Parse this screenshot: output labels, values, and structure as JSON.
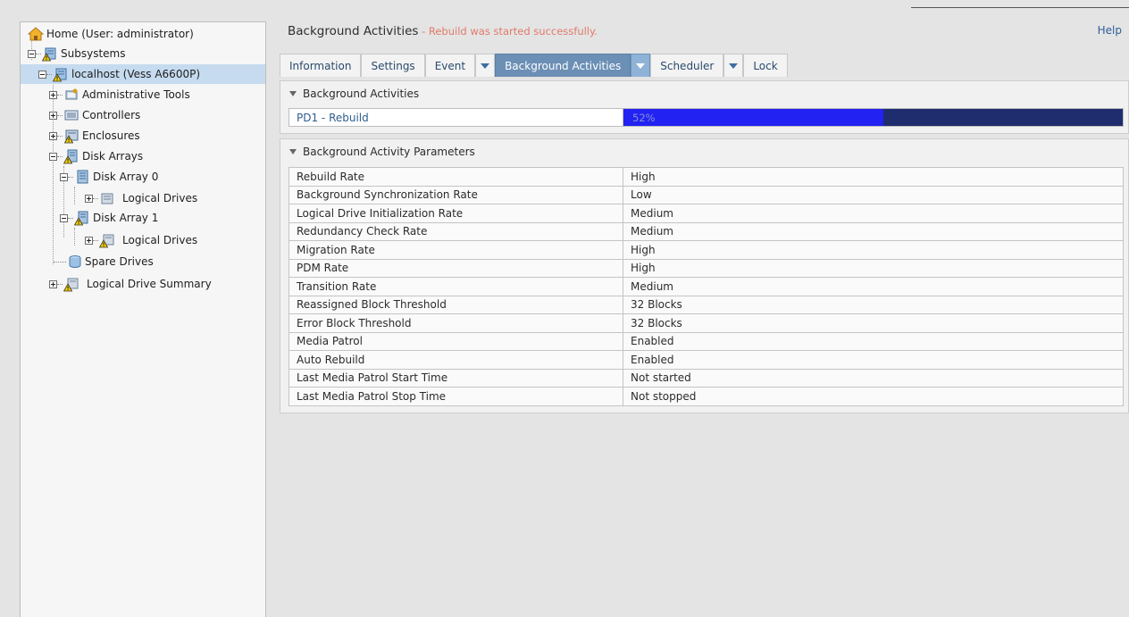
{
  "tree": {
    "nodes": [
      {
        "label": "Home (User: administrator)"
      },
      {
        "label": "Subsystems"
      },
      {
        "label": "localhost (Vess A6600P)"
      },
      {
        "label": "Administrative Tools"
      },
      {
        "label": "Controllers"
      },
      {
        "label": "Enclosures"
      },
      {
        "label": "Disk Arrays"
      },
      {
        "label": "Disk Array 0"
      },
      {
        "label": "Logical Drives"
      },
      {
        "label": "Disk Array 1"
      },
      {
        "label": "Logical Drives"
      },
      {
        "label": "Spare Drives"
      },
      {
        "label": "Logical Drive Summary"
      }
    ]
  },
  "header": {
    "title": "Background Activities",
    "status": " - Rebuild was started successfully.",
    "help": "Help"
  },
  "tabs": [
    {
      "label": "Information"
    },
    {
      "label": "Settings"
    },
    {
      "label": "Event"
    },
    {
      "label": "Background Activities"
    },
    {
      "label": "Scheduler"
    },
    {
      "label": "Lock"
    }
  ],
  "activities": {
    "heading": "Background Activities",
    "items": [
      {
        "name": "PD1 - Rebuild",
        "progress_text": "52%",
        "progress": 0.52
      }
    ]
  },
  "parameters": {
    "heading": "Background Activity Parameters",
    "rows": [
      {
        "key": "Rebuild Rate",
        "value": "High"
      },
      {
        "key": "Background Synchronization Rate",
        "value": "Low"
      },
      {
        "key": "Logical Drive Initialization Rate",
        "value": "Medium"
      },
      {
        "key": "Redundancy Check Rate",
        "value": "Medium"
      },
      {
        "key": "Migration Rate",
        "value": "High"
      },
      {
        "key": "PDM Rate",
        "value": "High"
      },
      {
        "key": "Transition Rate",
        "value": "Medium"
      },
      {
        "key": "Reassigned Block Threshold",
        "value": "32 Blocks"
      },
      {
        "key": "Error Block Threshold",
        "value": "32 Blocks"
      },
      {
        "key": "Media Patrol",
        "value": "Enabled"
      },
      {
        "key": "Auto Rebuild",
        "value": "Enabled"
      },
      {
        "key": "Last Media Patrol Start Time",
        "value": "Not started"
      },
      {
        "key": "Last Media Patrol Stop Time",
        "value": "Not stopped"
      }
    ]
  },
  "colors": {
    "selected_tab": "#6b8fb5",
    "progress_fill": "#2222f2",
    "progress_track": "#1f2d6e",
    "status_text": "#e07a6a",
    "tree_selected": "#c6dbef"
  }
}
